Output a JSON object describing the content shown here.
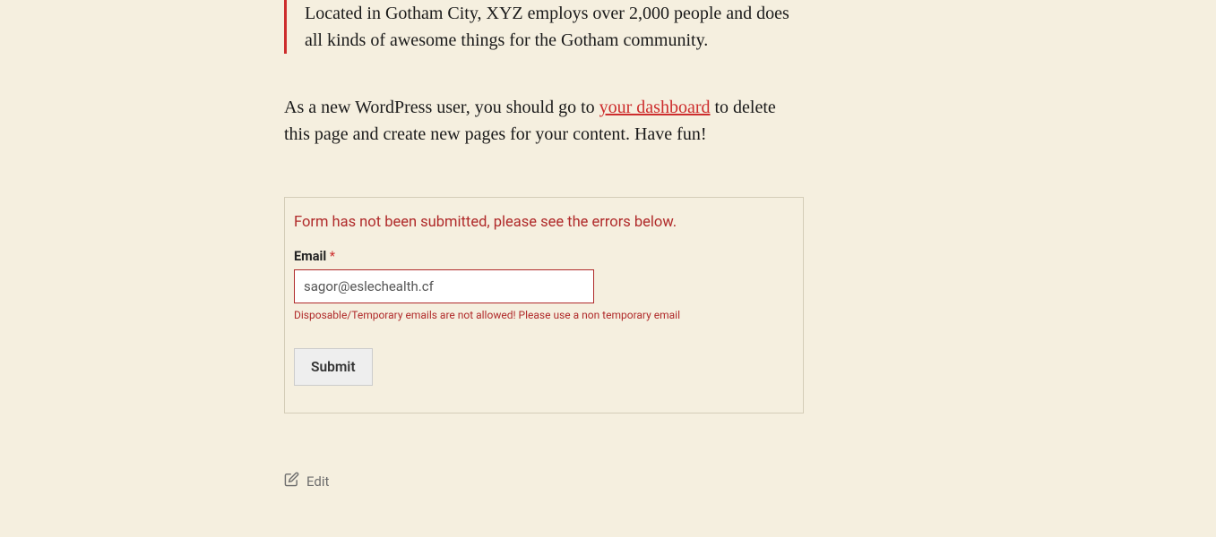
{
  "blockquote": {
    "text": "Located in Gotham City, XYZ employs over 2,000 people and does all kinds of awesome things for the Gotham community."
  },
  "paragraph": {
    "before_link": "As a new WordPress user, you should go to ",
    "link_text": "your dashboard",
    "after_link": " to delete this page and create new pages for your content. Have fun!"
  },
  "form": {
    "error_summary": "Form has not been submitted, please see the errors below.",
    "email_label": "Email",
    "required_mark": "*",
    "email_value": "sagor@eslechealth.cf",
    "email_error": "Disposable/Temporary emails are not allowed! Please use a non temporary email",
    "submit_label": "Submit"
  },
  "footer": {
    "edit_label": "Edit"
  }
}
